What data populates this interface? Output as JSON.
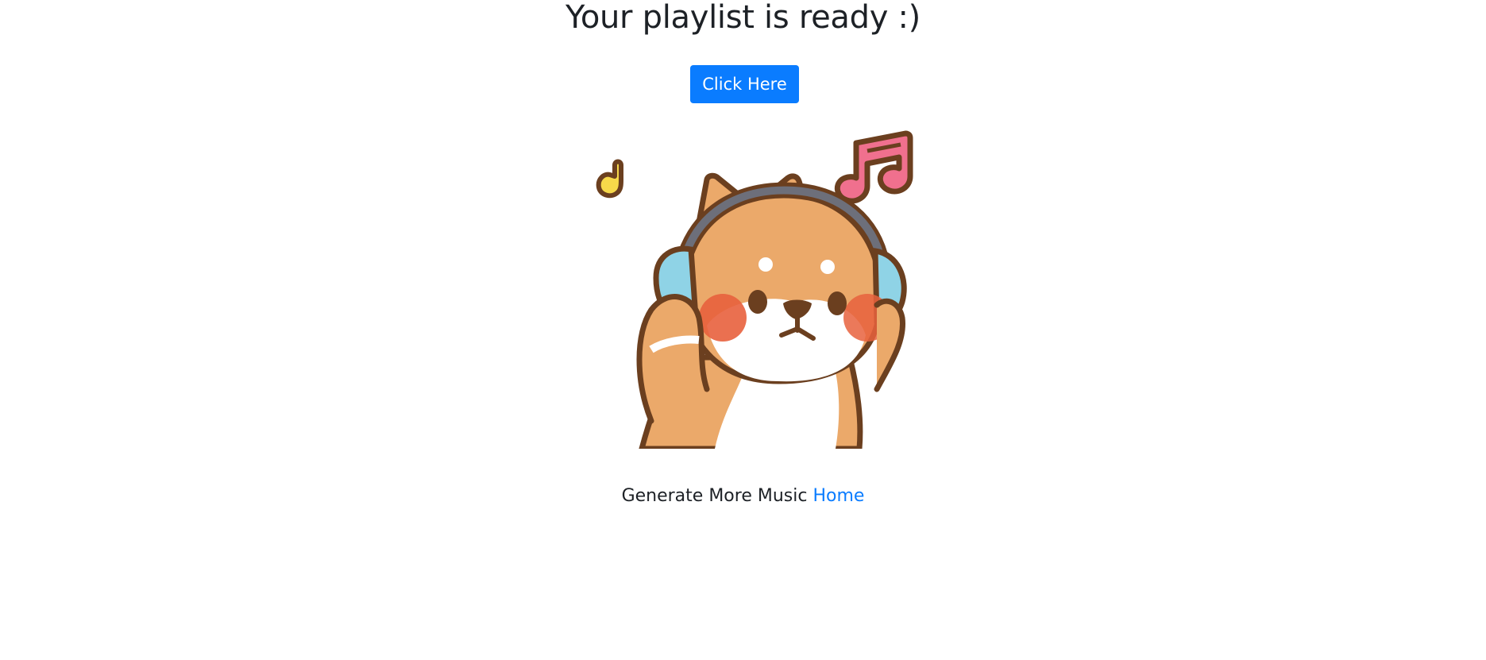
{
  "page": {
    "title": "Your playlist is ready :)",
    "button_label": "Click Here",
    "footer_text": "Generate More Music",
    "footer_link": "Home"
  },
  "colors": {
    "button": "#0a7cff",
    "link": "#0a7cff",
    "text": "#1d2126"
  },
  "illustration": {
    "icon": "shiba-dog-with-headphones",
    "notes": [
      "yellow-music-note-icon",
      "pink-music-notes-icon"
    ]
  }
}
